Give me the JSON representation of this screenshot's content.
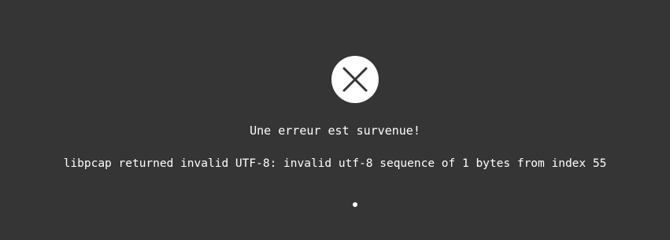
{
  "error": {
    "icon": "close-circle-icon",
    "title": "Une erreur est survenue!",
    "message": "libpcap returned invalid UTF-8: invalid utf-8 sequence of 1 bytes from index 55"
  },
  "colors": {
    "background": "#353535",
    "foreground": "#ffffff",
    "icon_glyph": "#353535"
  }
}
